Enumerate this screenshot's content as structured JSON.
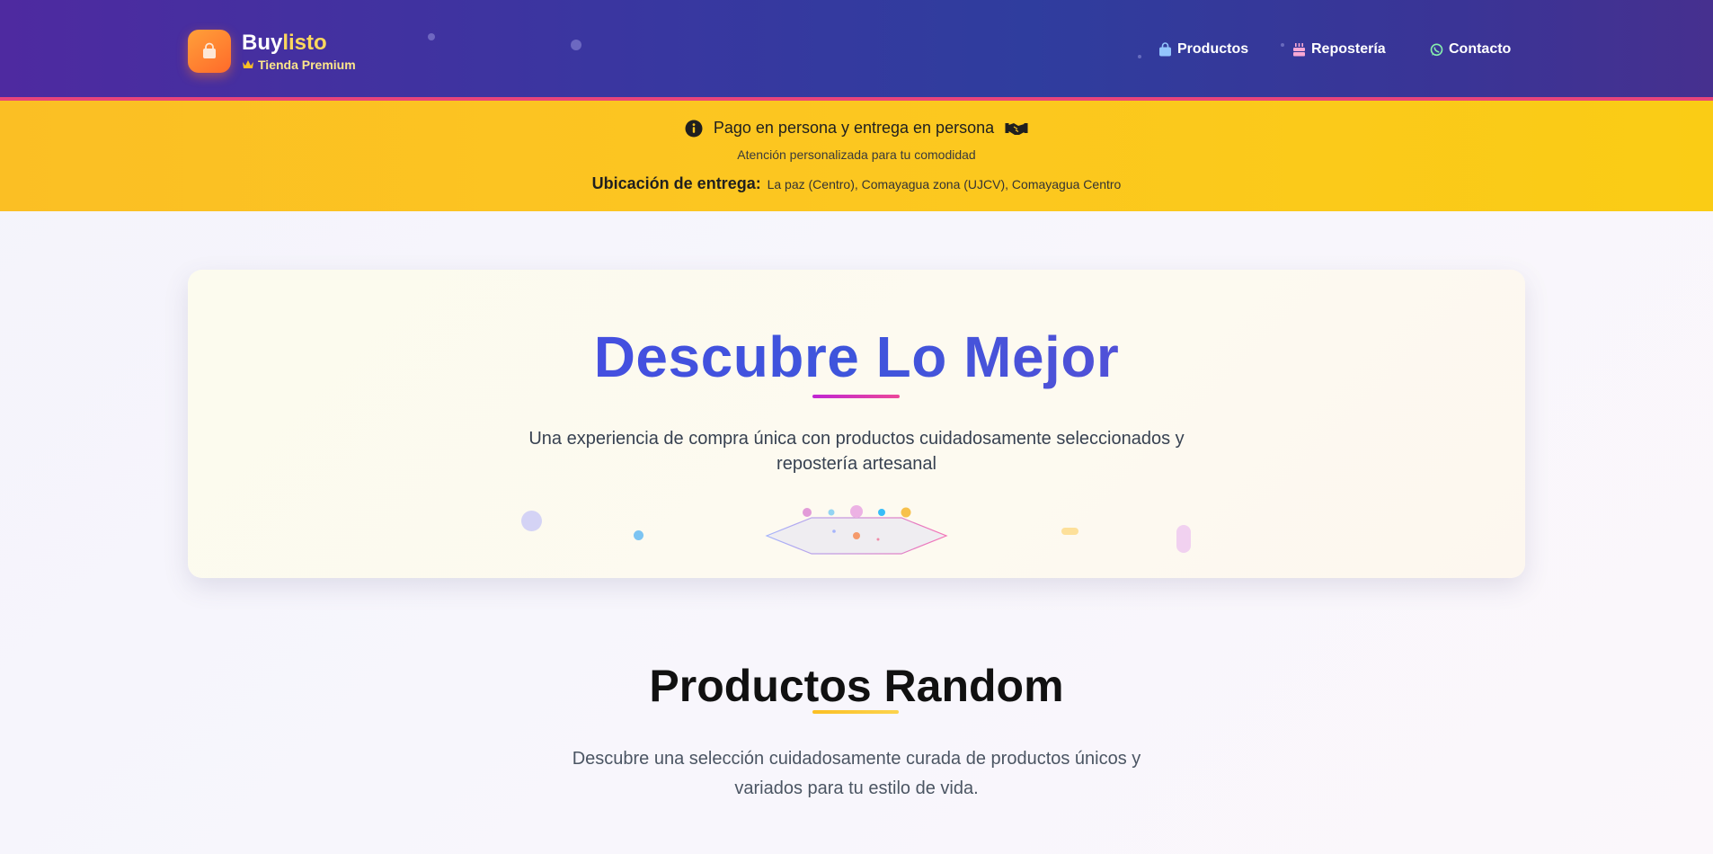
{
  "brand": {
    "name_main": "Buy",
    "name_accent": "listo",
    "tagline": "Tienda Premium",
    "logo_icon": "shopping-bag-icon",
    "tagline_icon": "crown-icon"
  },
  "nav": {
    "items": [
      {
        "label": "Productos",
        "icon": "shopping-bag-icon"
      },
      {
        "label": "Repostería",
        "icon": "cake-icon"
      },
      {
        "label": "Contacto",
        "icon": "whatsapp-icon"
      }
    ]
  },
  "notice": {
    "title": "Pago en persona y entrega en persona",
    "info_icon": "info-circle-icon",
    "handshake_icon": "handshake-icon",
    "subtitle": "Atención personalizada para tu comodidad",
    "location_label": "Ubicación de entrega:",
    "location_value": "La paz (Centro), Comayagua zona (UJCV), Comayagua Centro"
  },
  "hero": {
    "title": "Descubre Lo Mejor",
    "description": "Una experiencia de compra única con productos cuidadosamente seleccionados y repostería artesanal"
  },
  "section": {
    "title": "Productos Random",
    "description": "Descubre una selección cuidadosamente curada de productos únicos y variados para tu estilo de vida."
  },
  "colors": {
    "header_start": "#4e2aa0",
    "header_end": "#46308f",
    "notice_bg": "#fbbf24",
    "hero_title": "#4f46e5",
    "brand_accent": "#fdd85d",
    "logo_orange": "#ff7a2a"
  }
}
